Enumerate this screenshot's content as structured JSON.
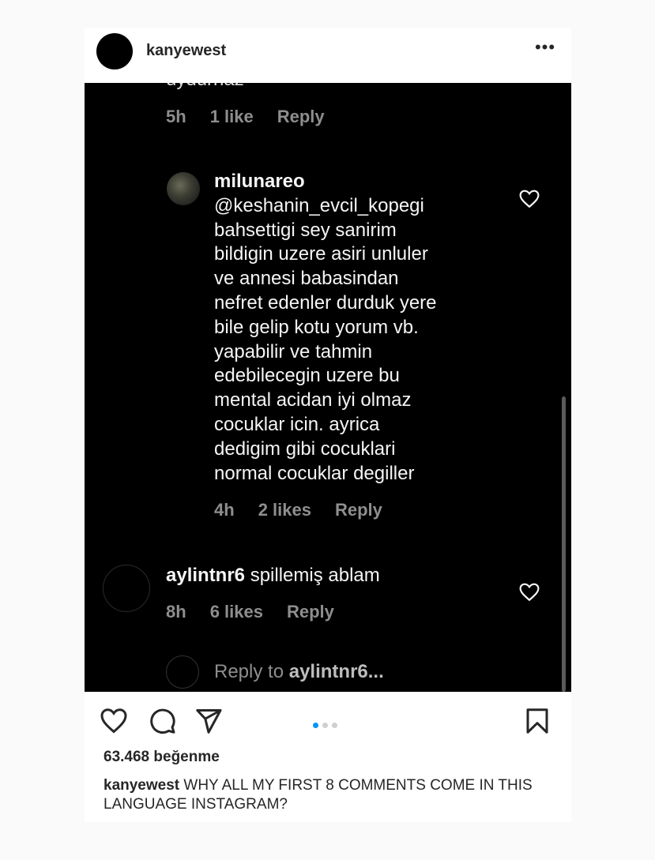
{
  "header": {
    "username": "kanyewest",
    "more_icon": "ellipsis-icon"
  },
  "screenshot": {
    "clipped_text": "uydurnaz",
    "first_meta": {
      "time": "5h",
      "likes": "1 like",
      "reply": "Reply"
    },
    "reply": {
      "username": "milunareo",
      "text": "@keshanin_evcil_kopegi\nbahsettigi sey  sanirim\nbildigin uzere asiri unluler\nve annesi babasindan\nnefret edenler durduk yere\nbile gelip kotu yorum vb.\nyapabilir ve tahmin\nedebilecegin uzere bu\nmental acidan iyi olmaz\ncocuklar icin. ayrica\ndedigim gibi cocuklari\nnormal cocuklar degiller",
      "time": "4h",
      "likes": "2 likes",
      "reply": "Reply"
    },
    "comment": {
      "username": "aylintnr6",
      "text": "spillemiş ablam",
      "time": "8h",
      "likes": "6 likes",
      "reply": "Reply"
    },
    "input": {
      "prefix": "Reply to ",
      "target": "aylintnr6..."
    }
  },
  "footer": {
    "icons": [
      "heart-icon",
      "comment-icon",
      "share-icon",
      "bookmark-icon"
    ],
    "carousel": {
      "count": 3,
      "active": 1,
      "active_color": "#0095f6"
    },
    "likes": "63.468 beğenme",
    "caption_user": "kanyewest",
    "caption_text": "WHY ALL MY FIRST 8 COMMENTS COME IN THIS LANGUAGE INSTAGRAM?"
  }
}
